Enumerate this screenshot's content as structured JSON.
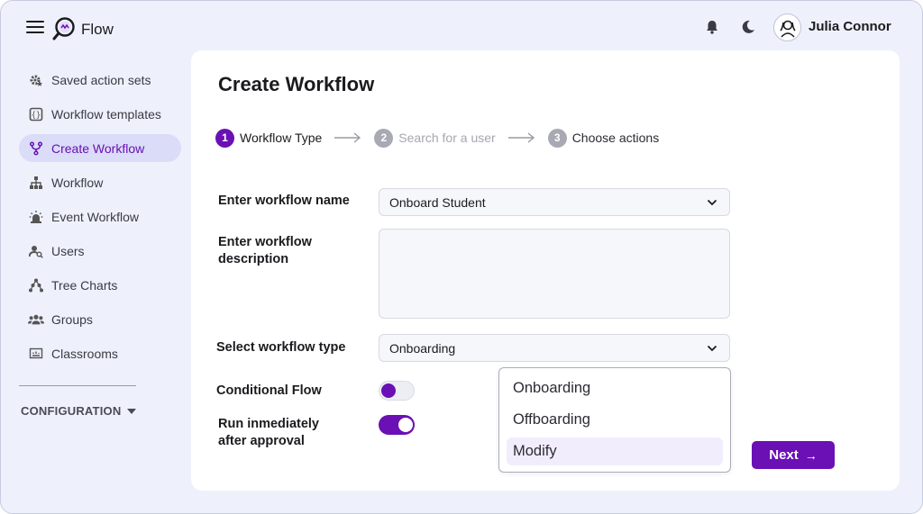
{
  "app": {
    "title": "Flow"
  },
  "header": {
    "user_name": "Julia Connor"
  },
  "sidebar": {
    "items": [
      {
        "label": "Saved action sets",
        "icon": "gear-star-icon",
        "active": false
      },
      {
        "label": "Workflow templates",
        "icon": "braces-icon",
        "active": false
      },
      {
        "label": "Create Workflow",
        "icon": "branch-icon",
        "active": true
      },
      {
        "label": "Workflow",
        "icon": "hierarchy-icon",
        "active": false
      },
      {
        "label": "Event Workflow",
        "icon": "alarm-icon",
        "active": false
      },
      {
        "label": "Users",
        "icon": "user-search-icon",
        "active": false
      },
      {
        "label": "Tree Charts",
        "icon": "tree-icon",
        "active": false
      },
      {
        "label": "Groups",
        "icon": "group-icon",
        "active": false
      },
      {
        "label": "Classrooms",
        "icon": "classroom-icon",
        "active": false
      }
    ],
    "config_label": "CONFIGURATION"
  },
  "main": {
    "title": "Create Workflow",
    "steps": [
      {
        "num": "1",
        "label": "Workflow Type",
        "state": "active"
      },
      {
        "num": "2",
        "label": "Search for a user",
        "state": "inactive"
      },
      {
        "num": "3",
        "label": "Choose actions",
        "state": "inactive"
      }
    ],
    "form": {
      "name_label": "Enter workflow name",
      "name_value": "Onboard Student",
      "desc_label_line1": "Enter workflow",
      "desc_label_line2": "description",
      "desc_value": "",
      "type_label": "Select workflow type",
      "type_value": "Onboarding",
      "conditional_label": "Conditional Flow",
      "conditional_on": false,
      "run_label_line1": "Run inmediately",
      "run_label_line2": "after approval",
      "run_on": true
    },
    "dropdown_options": [
      {
        "label": "Onboarding",
        "selected": false
      },
      {
        "label": "Offboarding",
        "selected": false
      },
      {
        "label": "Modify",
        "selected": true
      }
    ],
    "next_label": "Next",
    "next_arrow": "→"
  },
  "colors": {
    "accent": "#6a10b4",
    "sidebar_active_bg": "#dadcf8",
    "page_bg": "#eef1fb",
    "muted_step": "#a9a9b3"
  }
}
